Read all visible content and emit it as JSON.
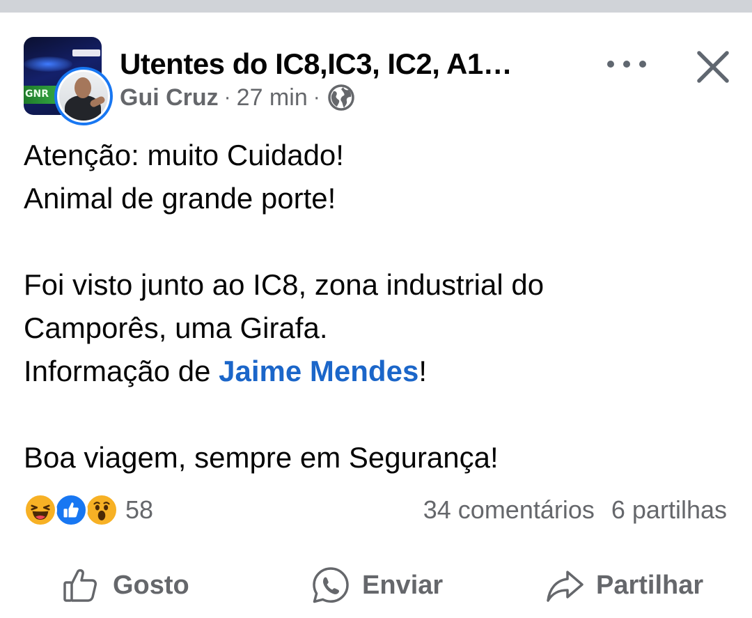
{
  "group": {
    "name": "Utentes do IC8,IC3, IC2, A1…",
    "avatar_text": "GNR"
  },
  "post": {
    "author": "Gui Cruz",
    "separator": "·",
    "time": "27 min",
    "privacy_icon": "globe-icon",
    "lines": {
      "l1": "Atenção: muito Cuidado!",
      "l2": "Animal de grande porte!",
      "l3": "Foi visto junto ao IC8, zona industrial do",
      "l4": "Camporês,  uma Girafa.",
      "l5_prefix": "Informação de ",
      "l5_mention": "Jaime Mendes",
      "l5_suffix": "!",
      "l6": "Boa viagem, sempre em Segurança!"
    }
  },
  "reactions": {
    "types": [
      "haha",
      "like",
      "wow"
    ],
    "count": "58"
  },
  "stats": {
    "comments": "34 comentários",
    "shares": "6 partilhas"
  },
  "actions": {
    "like": "Gosto",
    "send": "Enviar",
    "share": "Partilhar"
  },
  "colors": {
    "accent": "#1877f2",
    "mention": "#1b66c9",
    "secondary_text": "#65676b",
    "text": "#050505"
  }
}
